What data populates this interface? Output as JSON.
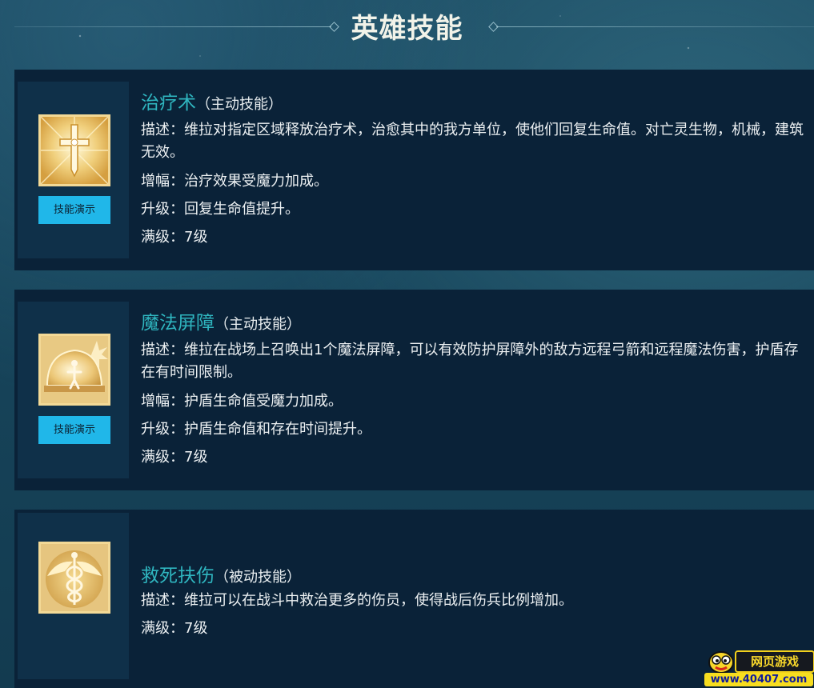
{
  "page": {
    "title": "英雄技能"
  },
  "skills": [
    {
      "name": "治疗术",
      "type": "（主动技能）",
      "icon": "holy-cross-icon",
      "demo_label": "技能演示",
      "lines": [
        "描述：维拉对指定区域释放治疗术，治愈其中的我方单位，使他们回复生命值。对亡灵生物，机械，建筑无效。",
        "增幅：治疗效果受魔力加成。",
        "升级：回复生命值提升。",
        "满级：7级"
      ]
    },
    {
      "name": "魔法屏障",
      "type": "（主动技能）",
      "icon": "magic-shield-icon",
      "demo_label": "技能演示",
      "lines": [
        "描述：维拉在战场上召唤出1个魔法屏障，可以有效防护屏障外的敌方远程弓箭和远程魔法伤害，护盾存在有时间限制。",
        "增幅：护盾生命值受魔力加成。",
        "升级：护盾生命值和存在时间提升。",
        "满级：7级"
      ]
    },
    {
      "name": "救死扶伤",
      "type": "（被动技能）",
      "icon": "caduceus-icon",
      "lines": [
        "描述：维拉可以在战斗中救治更多的伤员，使得战后伤兵比例增加。",
        "满级：7级"
      ]
    }
  ],
  "watermark": {
    "top_text": "网页游戏",
    "bottom_text": "www.40407.com"
  },
  "colors": {
    "accent_teal": "#2fb5bf",
    "button_blue": "#20b7e9",
    "card_bg": "#0a2238",
    "icon_gold": "#f3d996"
  }
}
